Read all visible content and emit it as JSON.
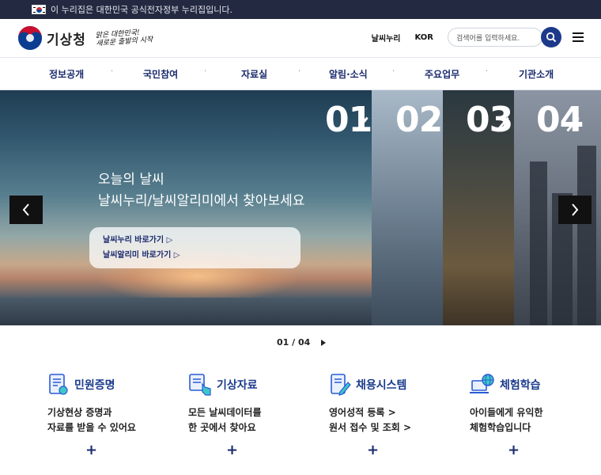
{
  "gov_banner": {
    "text": "이 누리집은 대한민국 공식전자정부 누리집입니다."
  },
  "header": {
    "logo_name": "기상청",
    "slogan_line1": "맑은 대한민국!",
    "slogan_line2": "새로운 출발의 시작",
    "links": [
      "날씨누리",
      "KOR"
    ],
    "search_placeholder": "검색어를 입력하세요."
  },
  "nav": {
    "items": [
      "정보공개",
      "국민참여",
      "자료실",
      "알림·소식",
      "주요업무",
      "기관소개"
    ]
  },
  "hero": {
    "numbers": [
      "01",
      "02",
      "03",
      "04"
    ],
    "title_line1": "오늘의 날씨",
    "title_line2": "날씨누리/날씨알리미에서 찾아보세요",
    "link1": "날씨누리 바로가기 ▷",
    "link2": "날씨알리미 바로가기 ▷"
  },
  "pager": {
    "text": "01 / 04"
  },
  "quick_links": [
    {
      "title": "민원증명",
      "desc_line1": "기상현상 증명과",
      "desc_line2": "자료를 받을 수 있어요",
      "icon": "certificate-icon"
    },
    {
      "title": "기상자료",
      "desc_line1": "모든 날씨데이터를",
      "desc_line2": "한 곳에서 찾아요",
      "icon": "data-touch-icon"
    },
    {
      "title": "채용시스템",
      "desc_line1": "영어성적 등록  >",
      "desc_line2": "원서 접수 및 조회  >",
      "icon": "document-pen-icon"
    },
    {
      "title": "체험학습",
      "desc_line1": "아이들에게 유익한",
      "desc_line2": "체험학습입니다",
      "icon": "globe-laptop-icon"
    }
  ],
  "colors": {
    "brand_navy": "#1a2b6d",
    "search_blue": "#1d3a8a",
    "gov_bar": "#232940"
  }
}
